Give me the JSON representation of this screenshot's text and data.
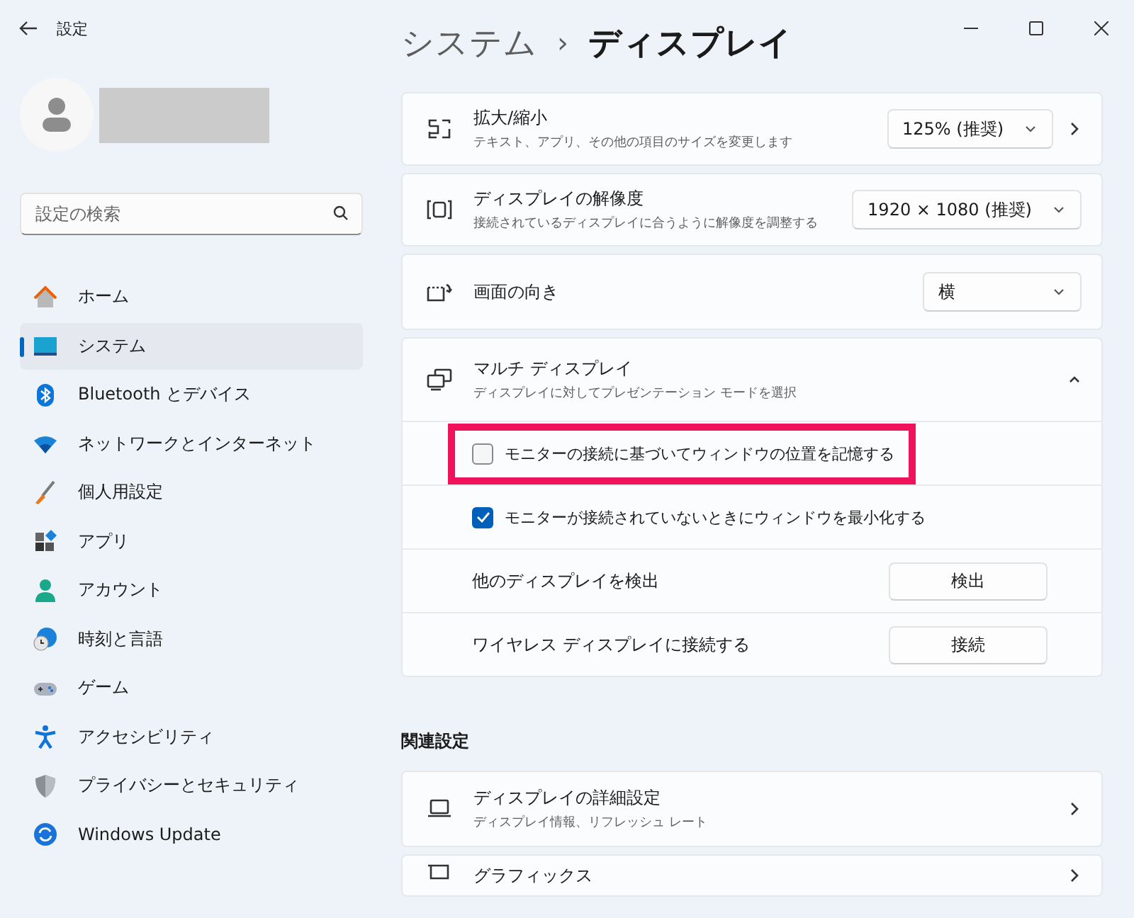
{
  "window": {
    "title": "設定"
  },
  "sidebar": {
    "search": {
      "placeholder": "設定の検索"
    },
    "items": [
      {
        "label": "ホーム",
        "selected": false
      },
      {
        "label": "システム",
        "selected": true
      },
      {
        "label": "Bluetooth とデバイス",
        "selected": false
      },
      {
        "label": "ネットワークとインターネット",
        "selected": false
      },
      {
        "label": "個人用設定",
        "selected": false
      },
      {
        "label": "アプリ",
        "selected": false
      },
      {
        "label": "アカウント",
        "selected": false
      },
      {
        "label": "時刻と言語",
        "selected": false
      },
      {
        "label": "ゲーム",
        "selected": false
      },
      {
        "label": "アクセシビリティ",
        "selected": false
      },
      {
        "label": "プライバシーとセキュリティ",
        "selected": false
      },
      {
        "label": "Windows Update",
        "selected": false
      }
    ]
  },
  "breadcrumb": {
    "parent": "システム",
    "separator": "›",
    "current": "ディスプレイ"
  },
  "cards": [
    {
      "kind": "dropdown",
      "title": "拡大/縮小",
      "subtitle": "テキスト、アプリ、その他の項目のサイズを変更します",
      "value": "125% (推奨)",
      "chevron": true
    },
    {
      "kind": "dropdown",
      "title": "ディスプレイの解像度",
      "subtitle": "接続されているディスプレイに合うように解像度を調整する",
      "value": "1920 × 1080 (推奨)",
      "chevron": false
    },
    {
      "kind": "dropdown",
      "title": "画面の向き",
      "value": "横",
      "chevron": false
    },
    {
      "kind": "expander",
      "title": "マルチ ディスプレイ",
      "subtitle": "ディスプレイに対してプレゼンテーション モードを選択",
      "expanded": true,
      "rows": [
        {
          "kind": "checkbox",
          "label": "モニターの接続に基づいてウィンドウの位置を記憶する",
          "checked": false,
          "highlighted": true
        },
        {
          "kind": "checkbox",
          "label": "モニターが接続されていないときにウィンドウを最小化する",
          "checked": true,
          "highlighted": false
        },
        {
          "kind": "button",
          "label": "他のディスプレイを検出",
          "button": "検出"
        },
        {
          "kind": "button",
          "label": "ワイヤレス ディスプレイに接続する",
          "button": "接続"
        }
      ]
    }
  ],
  "related": {
    "heading": "関連設定",
    "cards": [
      {
        "title": "ディスプレイの詳細設定",
        "subtitle": "ディスプレイ情報、リフレッシュ レート"
      },
      {
        "title": "グラフィックス"
      }
    ]
  }
}
